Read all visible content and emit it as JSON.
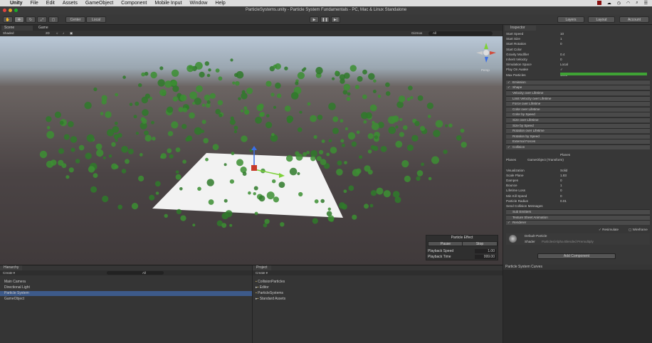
{
  "menubar": {
    "items": [
      "Unity",
      "File",
      "Edit",
      "Assets",
      "GameObject",
      "Component",
      "Mobile Input",
      "Window",
      "Help"
    ],
    "status_icons": [
      "record-icon",
      "cloud-icon",
      "time-icon",
      "wifi-icon",
      "search-icon",
      "list-icon"
    ]
  },
  "window": {
    "title": "ParticleSystems.unity - Particle System Fundamentals - PC, Mac & Linux Standalone"
  },
  "toolbar": {
    "pivot": "Center",
    "space": "Local",
    "layers": "Layers",
    "layout": "Layout",
    "account": "Account"
  },
  "scene": {
    "tabs": [
      "Scene",
      "Game"
    ],
    "shading": "Shaded",
    "mode_2d": "2D",
    "gizmos": "Gizmos",
    "search_placeholder": "All",
    "axis_label": "Persp"
  },
  "particle_effect": {
    "title": "Particle Effect",
    "pause": "Pause",
    "stop": "Stop",
    "playback_speed_label": "Playback Speed",
    "playback_speed": "1.00",
    "playback_time_label": "Playback Time",
    "playback_time": "999.00"
  },
  "inspector": {
    "tab": "Inspector",
    "properties": [
      {
        "label": "Start Speed",
        "value": "10"
      },
      {
        "label": "Start Size",
        "value": "1"
      },
      {
        "label": "Start Rotation",
        "value": "0"
      },
      {
        "label": "Start Color",
        "value": ""
      },
      {
        "label": "Gravity Modifier",
        "value": "0.4"
      },
      {
        "label": "Inherit Velocity",
        "value": "0"
      },
      {
        "label": "Simulation Space",
        "value": "Local"
      },
      {
        "label": "Play On Awake",
        "value": "✓"
      },
      {
        "label": "Max Particles",
        "value": "1000"
      }
    ],
    "start_color": "#3fa335",
    "modules": [
      {
        "label": "Emission",
        "checked": "✓"
      },
      {
        "label": "Shape",
        "checked": "✓"
      },
      {
        "label": "Velocity over Lifetime",
        "checked": ""
      },
      {
        "label": "Limit Velocity over Lifetime",
        "checked": ""
      },
      {
        "label": "Force over Lifetime",
        "checked": ""
      },
      {
        "label": "Color over Lifetime",
        "checked": ""
      },
      {
        "label": "Color by Speed",
        "checked": ""
      },
      {
        "label": "Size over Lifetime",
        "checked": ""
      },
      {
        "label": "Size by Speed",
        "checked": ""
      },
      {
        "label": "Rotation over Lifetime",
        "checked": ""
      },
      {
        "label": "Rotation by Speed",
        "checked": ""
      },
      {
        "label": "External Forces",
        "checked": ""
      },
      {
        "label": "Collision",
        "checked": "✓"
      }
    ],
    "collision_mode": "Planes",
    "planes_label": "Planes",
    "planes_value": "GameObject (Transform)",
    "collision_props": [
      {
        "label": "Visualization",
        "value": "Solid"
      },
      {
        "label": "Scale Plane",
        "value": "1.83"
      },
      {
        "label": "Dampen",
        "value": "0"
      },
      {
        "label": "Bounce",
        "value": "1"
      },
      {
        "label": "Lifetime Loss",
        "value": "0"
      },
      {
        "label": "Min Kill Speed",
        "value": "0"
      },
      {
        "label": "Particle Radius",
        "value": "0.01"
      },
      {
        "label": "Send Collision Messages",
        "value": ""
      }
    ],
    "modules2": [
      {
        "label": "Sub Emitters",
        "checked": ""
      },
      {
        "label": "Texture Sheet Animation",
        "checked": ""
      },
      {
        "label": "Renderer",
        "checked": "✓"
      }
    ],
    "resimulate": "Resimulate",
    "wireframe": "Wireframe",
    "material_name": "Default-Particle",
    "shader_label": "Shader",
    "shader_value": "Particles/Alpha Blended Premultiply",
    "add_component": "Add Component"
  },
  "hierarchy": {
    "tab": "Hierarchy",
    "create": "Create ▾",
    "search_placeholder": "All",
    "items": [
      "Main Camera",
      "Directional Light",
      "Particle System",
      "GameObject"
    ]
  },
  "project": {
    "tab": "Project",
    "create": "Create ▾",
    "items": [
      "CollisionParticles",
      "Editor",
      "ParticleSystems",
      "Standard Assets"
    ]
  },
  "curves": {
    "title": "Particle System Curves"
  }
}
